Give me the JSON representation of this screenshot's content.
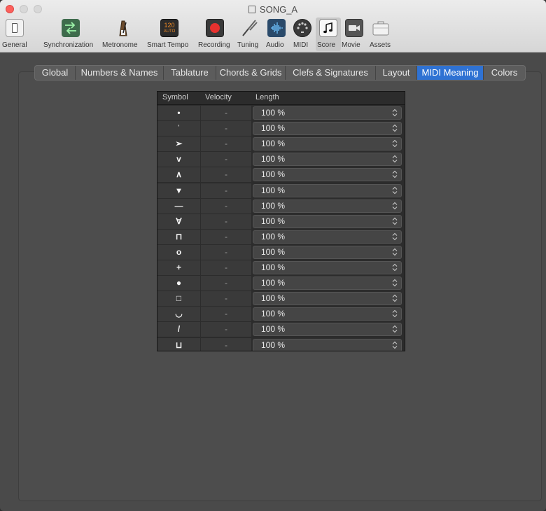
{
  "window": {
    "title": "SONG_A"
  },
  "toolbar": {
    "items": [
      {
        "label": "General",
        "icon": "general-icon"
      },
      {
        "label": "Synchronization",
        "icon": "synchronization-icon"
      },
      {
        "label": "Metronome",
        "icon": "metronome-icon"
      },
      {
        "label": "Smart Tempo",
        "icon": "smart-tempo-icon",
        "badge_top": "120",
        "badge_bottom": "AUTO"
      },
      {
        "label": "Recording",
        "icon": "record-icon"
      },
      {
        "label": "Tuning",
        "icon": "tuning-fork-icon"
      },
      {
        "label": "Audio",
        "icon": "audio-waveform-icon"
      },
      {
        "label": "MIDI",
        "icon": "midi-icon"
      },
      {
        "label": "Score",
        "icon": "music-note-icon"
      },
      {
        "label": "Movie",
        "icon": "movie-camera-icon"
      },
      {
        "label": "Assets",
        "icon": "briefcase-icon"
      }
    ],
    "selected": "Score"
  },
  "tabs": [
    {
      "label": "Global"
    },
    {
      "label": "Numbers & Names"
    },
    {
      "label": "Tablature"
    },
    {
      "label": "Chords & Grids"
    },
    {
      "label": "Clefs & Signatures"
    },
    {
      "label": "Layout"
    },
    {
      "label": "MIDI Meaning"
    },
    {
      "label": "Colors"
    }
  ],
  "active_tab": "MIDI Meaning",
  "table": {
    "headers": {
      "symbol": "Symbol",
      "velocity": "Velocity",
      "length": "Length"
    },
    "rows": [
      {
        "symbol": "•",
        "symbol_name": "staccato-dot",
        "velocity": "-",
        "length": "100 %"
      },
      {
        "symbol": "ˈ",
        "symbol_name": "staccatissimo-wedge",
        "velocity": "-",
        "length": "100 %"
      },
      {
        "symbol": "➢",
        "symbol_name": "accent",
        "velocity": "-",
        "length": "100 %"
      },
      {
        "symbol": "v",
        "symbol_name": "marcato-down",
        "velocity": "-",
        "length": "100 %"
      },
      {
        "symbol": "∧",
        "symbol_name": "marcato-up",
        "velocity": "-",
        "length": "100 %"
      },
      {
        "symbol": "▾",
        "symbol_name": "small-wedge",
        "velocity": "-",
        "length": "100 %"
      },
      {
        "symbol": "—",
        "symbol_name": "tenuto",
        "velocity": "-",
        "length": "100 %"
      },
      {
        "symbol": "∀",
        "symbol_name": "marcato-staccato",
        "velocity": "-",
        "length": "100 %"
      },
      {
        "symbol": "⊓",
        "symbol_name": "down-bow",
        "velocity": "-",
        "length": "100 %"
      },
      {
        "symbol": "o",
        "symbol_name": "harmonic",
        "velocity": "-",
        "length": "100 %"
      },
      {
        "symbol": "+",
        "symbol_name": "stopped",
        "velocity": "-",
        "length": "100 %"
      },
      {
        "symbol": "●",
        "symbol_name": "large-dot",
        "velocity": "-",
        "length": "100 %"
      },
      {
        "symbol": "□",
        "symbol_name": "square",
        "velocity": "-",
        "length": "100 %"
      },
      {
        "symbol": "◡",
        "symbol_name": "breve-curve",
        "velocity": "-",
        "length": "100 %"
      },
      {
        "symbol": "/",
        "symbol_name": "slash",
        "velocity": "-",
        "length": "100 %"
      },
      {
        "symbol": "⊔",
        "symbol_name": "open-bracket",
        "velocity": "-",
        "length": "100 %"
      }
    ]
  },
  "colors": {
    "accent": "#2f72d3",
    "record": "#e8322f",
    "smart_tempo": "#e07a1a"
  }
}
